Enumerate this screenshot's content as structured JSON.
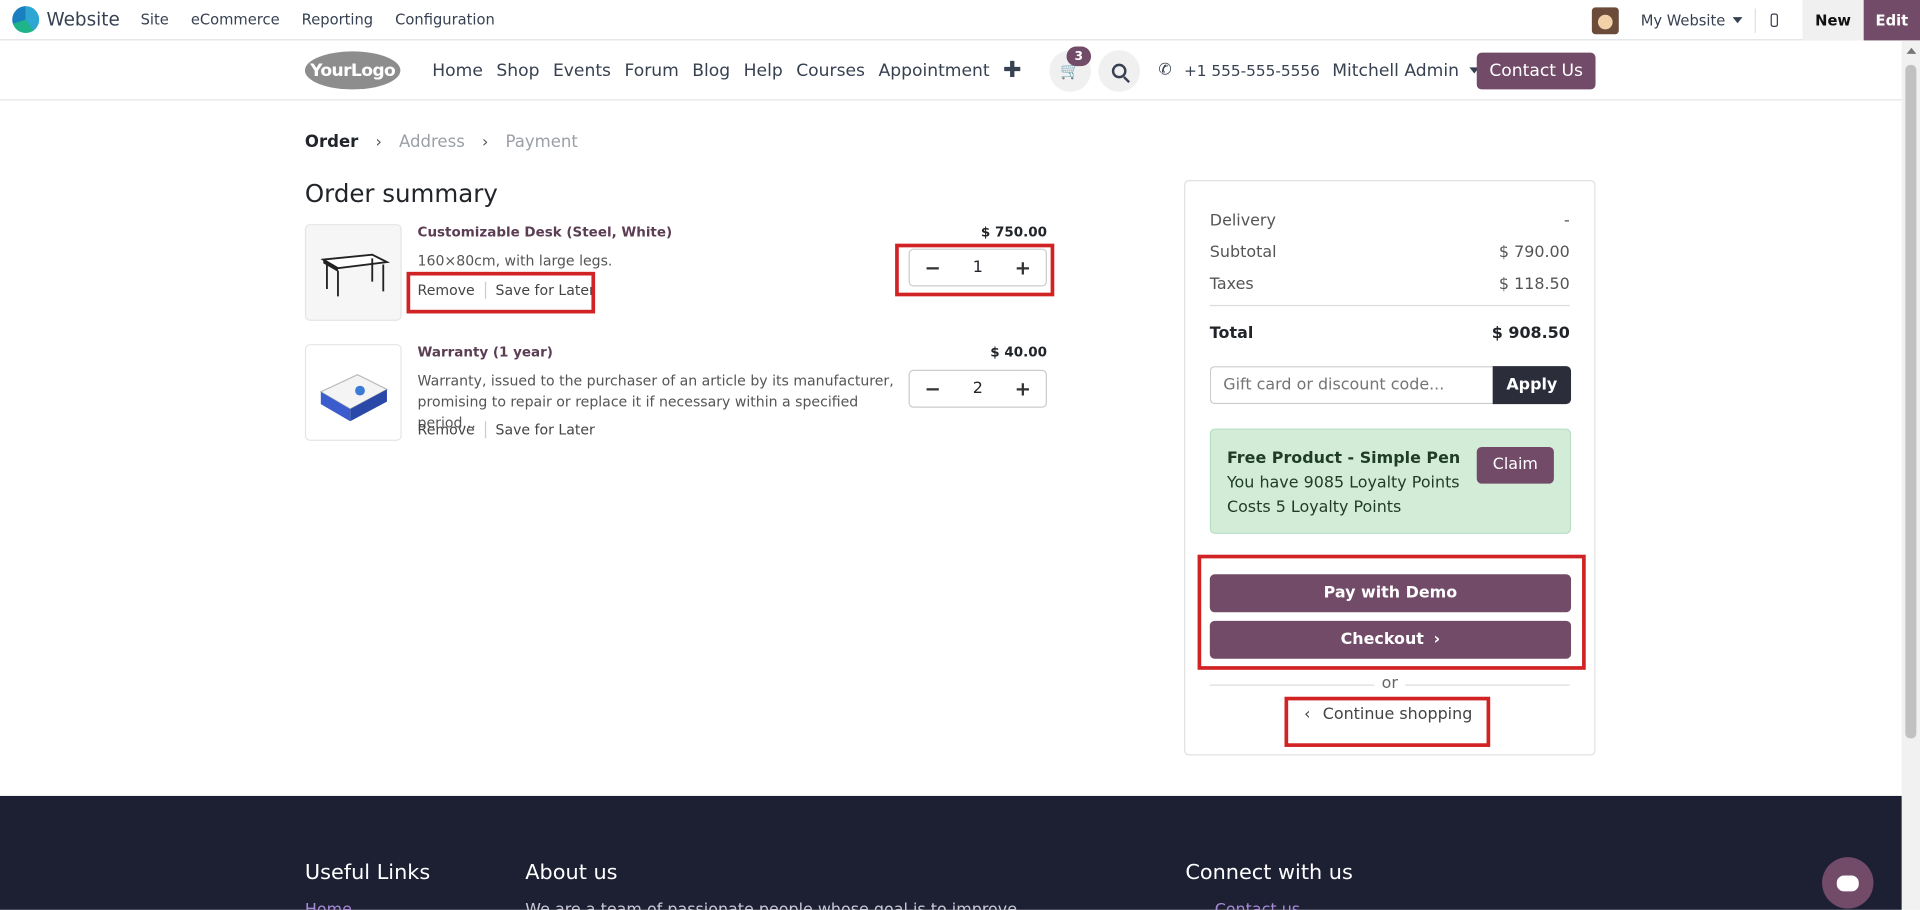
{
  "admin_bar": {
    "app_name": "Website",
    "menu": [
      "Site",
      "eCommerce",
      "Reporting",
      "Configuration"
    ],
    "website_switch": "My Website",
    "new_label": "New",
    "edit_label": "Edit"
  },
  "navbar": {
    "logo_text": "YourLogo",
    "links": [
      "Home",
      "Shop",
      "Events",
      "Forum",
      "Blog",
      "Help",
      "Courses",
      "Appointment"
    ],
    "plus": "✚",
    "cart_count": "3",
    "phone": "+1 555-555-5556",
    "user": "Mitchell Admin",
    "contact_label": "Contact Us"
  },
  "steps": [
    "Order",
    "Address",
    "Payment"
  ],
  "page_title": "Order summary",
  "lines": [
    {
      "name": "Customizable Desk (Steel, White)",
      "description": "160×80cm, with large legs.",
      "price": "$ 750.00",
      "quantity": "1",
      "remove": "Remove",
      "save_later": "Save for Later"
    },
    {
      "name": "Warranty (1 year)",
      "description": "Warranty, issued to the purchaser of an article by its manufacturer, promising to repair or replace it if necessary within a specified period...",
      "price": "$ 40.00",
      "quantity": "2",
      "remove": "Remove",
      "save_later": "Save for Later"
    }
  ],
  "summary": {
    "delivery_label": "Delivery",
    "delivery_value": "-",
    "subtotal_label": "Subtotal",
    "subtotal_value": "$ 790.00",
    "taxes_label": "Taxes",
    "taxes_value": "$ 118.50",
    "total_label": "Total",
    "total_value": "$ 908.50",
    "promo_placeholder": "Gift card or discount code...",
    "apply_label": "Apply",
    "reward_title": "Free Product - Simple Pen",
    "reward_line1": "You have 9085 Loyalty Points",
    "reward_line2": "Costs 5 Loyalty Points",
    "claim_label": "Claim",
    "pay_demo_label": "Pay with Demo",
    "checkout_label": "Checkout",
    "or_label": "or",
    "continue_label": "Continue shopping"
  },
  "footer": {
    "useful_links": "Useful Links",
    "about_us": "About us",
    "connect": "Connect with us",
    "home_link": "Home",
    "about_text": "We are a team of passionate people whose goal is to improve",
    "contact_link": "Contact us"
  },
  "colors": {
    "brand": "#714b67",
    "highlight": "#d12323",
    "footer_bg": "#1d1f33",
    "reward_bg": "#d2ecd8"
  }
}
